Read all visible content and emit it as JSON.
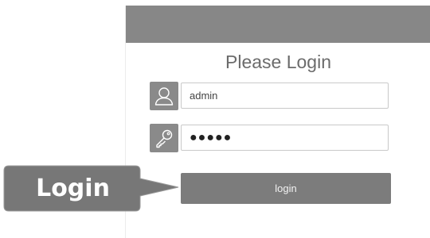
{
  "login_form": {
    "title": "Please Login",
    "username": {
      "value": "admin",
      "icon": "user-icon"
    },
    "password": {
      "value": "●●●●●",
      "icon": "key-icon"
    },
    "submit_label": "login"
  },
  "callout": {
    "label": "Login"
  },
  "colors": {
    "header": "#878787",
    "icon_box": "#8a8a8a",
    "button": "#7c7c7c",
    "callout": "#777777",
    "title_text": "#6b6b6b"
  }
}
